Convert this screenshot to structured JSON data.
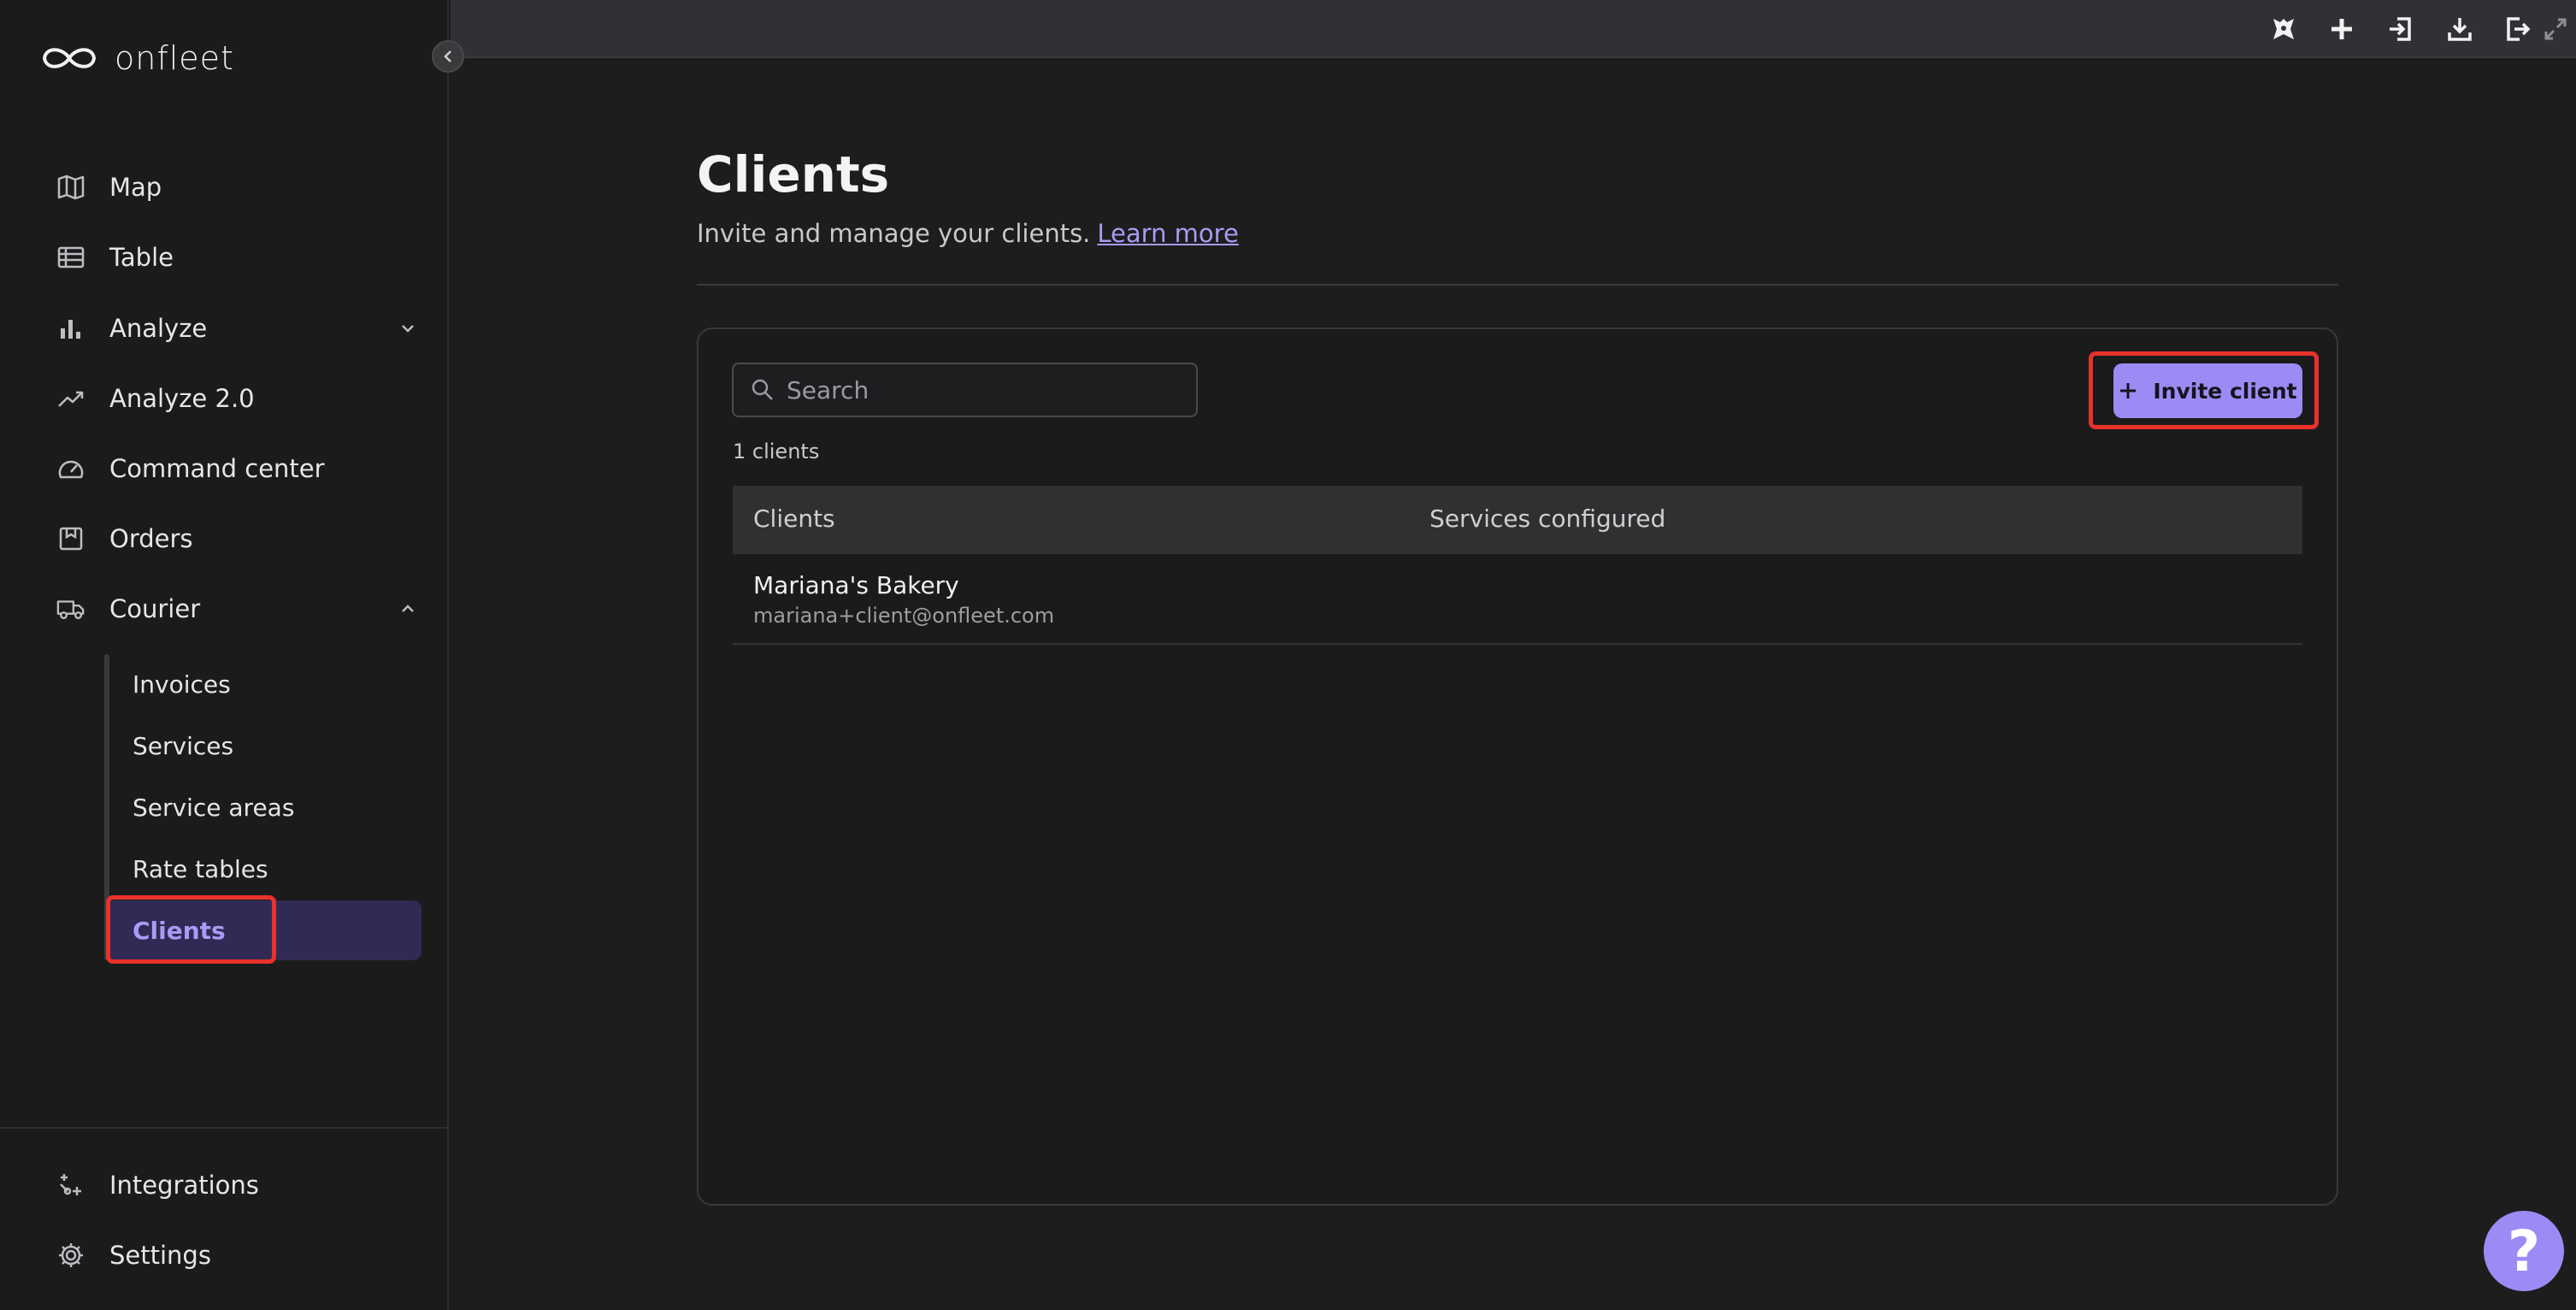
{
  "brand": {
    "name": "onfleet",
    "accent": "#9b8bf4"
  },
  "sidebar": {
    "nav": [
      {
        "label": "Map",
        "icon": "map-icon"
      },
      {
        "label": "Table",
        "icon": "table-icon"
      },
      {
        "label": "Analyze",
        "icon": "bar-chart-icon",
        "expandable": true,
        "expanded": false
      },
      {
        "label": "Analyze 2.0",
        "icon": "trending-icon"
      },
      {
        "label": "Command center",
        "icon": "gauge-icon"
      },
      {
        "label": "Orders",
        "icon": "orders-icon"
      },
      {
        "label": "Courier",
        "icon": "truck-icon",
        "expandable": true,
        "expanded": true
      }
    ],
    "courier_sub": [
      {
        "label": "Invoices"
      },
      {
        "label": "Services"
      },
      {
        "label": "Service areas"
      },
      {
        "label": "Rate tables"
      },
      {
        "label": "Clients",
        "active": true
      }
    ],
    "bottom": [
      {
        "label": "Integrations",
        "icon": "integrations-icon"
      },
      {
        "label": "Settings",
        "icon": "settings-icon"
      }
    ]
  },
  "topbar": {
    "icons": [
      "shortcut-icon",
      "plus-icon",
      "import-icon",
      "download-icon",
      "logout-icon",
      "fullscreen-icon"
    ]
  },
  "page": {
    "title": "Clients",
    "subtitle": "Invite and manage your clients.",
    "learn_more": "Learn more"
  },
  "search": {
    "placeholder": "Search",
    "value": ""
  },
  "invite_button": {
    "label": "Invite client"
  },
  "count_text": "1 clients",
  "table": {
    "columns": [
      "Clients",
      "Services configured"
    ],
    "rows": [
      {
        "name": "Mariana's Bakery",
        "email": "mariana+client@onfleet.com",
        "services": ""
      }
    ]
  },
  "help": {
    "label": "?"
  }
}
